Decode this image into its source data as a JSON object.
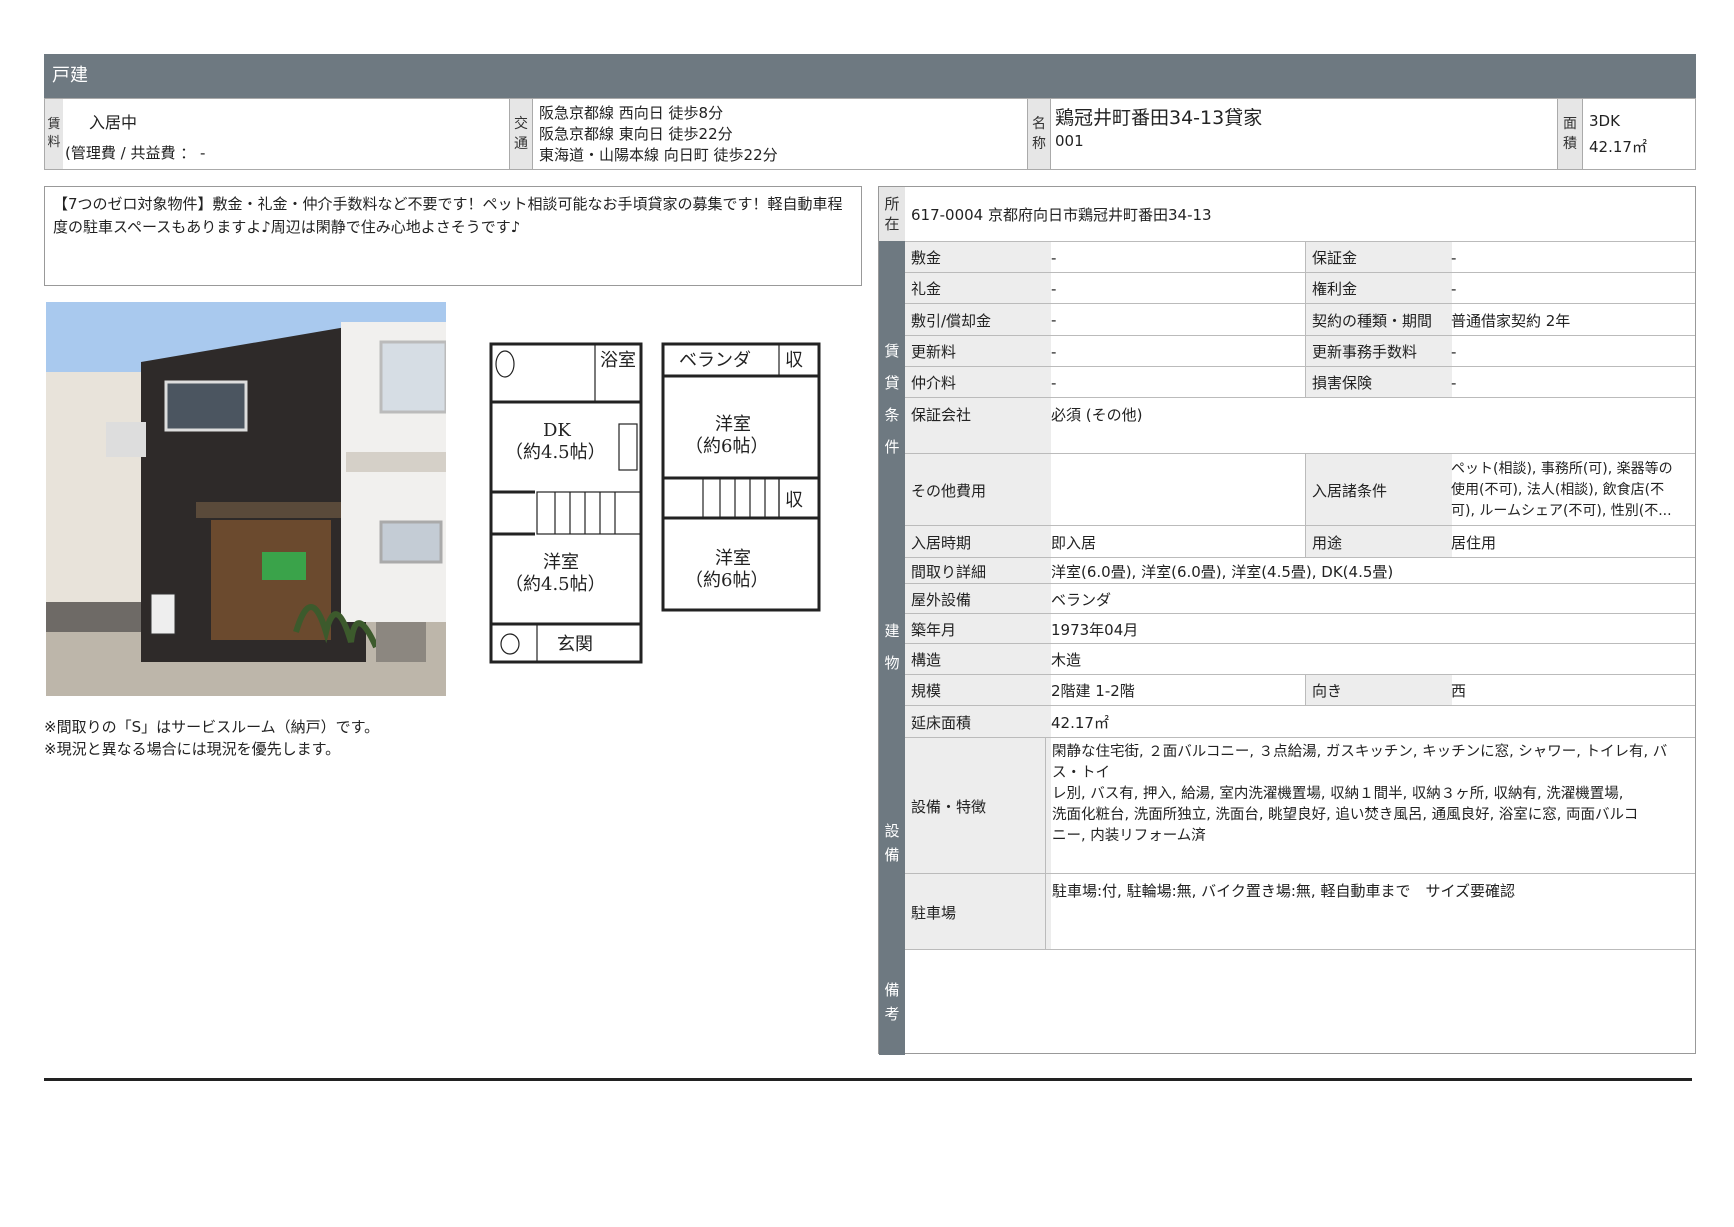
{
  "header": {
    "title": "戸建"
  },
  "top": {
    "rent_label": [
      "賃",
      "料"
    ],
    "rent_value": "入居中",
    "mgmt": "(管理費 / 共益費 ： -",
    "transit_label": [
      "交",
      "通"
    ],
    "transit": [
      "阪急京都線 西向日 徒歩8分",
      "阪急京都線 東向日 徒歩22分",
      "東海道・山陽本線 向日町 徒歩22分"
    ],
    "name_label": [
      "名",
      "称"
    ],
    "name": "鶏冠井町番田34-13貸家",
    "name_sub": "001",
    "area_label": [
      "面",
      "積"
    ],
    "layout": "3DK",
    "area": "42.17㎡"
  },
  "description": "【7つのゼロ対象物件】敷金・礼金・仲介手数料など不要です！ペット相談可能なお手頃貸家の募集です！軽自動車程度の駐車スペースもありますよ♪周辺は閑静で住み心地よさそうです♪",
  "notes": [
    "※間取りの「S」はサービスルーム（納戸）です。",
    "※現況と異なる場合には現況を優先します。"
  ],
  "floorplan": {
    "bath": "浴室",
    "dk": "DK",
    "dk_size": "（約4.5帖）",
    "w1": "洋室",
    "w1_size": "（約4.5帖）",
    "entrance": "玄関",
    "veranda": "ベランダ",
    "storage": "収",
    "w2": "洋室",
    "w2_size": "（約6帖）",
    "w3": "洋室",
    "w3_size": "（約6帖）"
  },
  "address": {
    "label": [
      "所",
      "在"
    ],
    "value": "617-0004 京都府向日市鶏冠井町番田34-13"
  },
  "sections": {
    "lease": [
      "賃",
      "貸",
      "条",
      "件"
    ],
    "building": [
      "建",
      "物"
    ],
    "equipment": [
      "設",
      "備"
    ],
    "remarks": [
      "備",
      "考"
    ]
  },
  "lease": {
    "shikikin": {
      "k": "敷金",
      "v": "-"
    },
    "hoshokin": {
      "k": "保証金",
      "v": "-"
    },
    "reikin": {
      "k": "礼金",
      "v": "-"
    },
    "kenrikin": {
      "k": "権利金",
      "v": "-"
    },
    "shikibiki": {
      "k": "敷引/償却金",
      "v": "-"
    },
    "contract": {
      "k": "契約の種類・期間",
      "v": "普通借家契約 2年"
    },
    "renewal": {
      "k": "更新料",
      "v": "-"
    },
    "renewal_fee": {
      "k": "更新事務手数料",
      "v": "-"
    },
    "brokerage": {
      "k": "仲介料",
      "v": "-"
    },
    "insurance": {
      "k": "損害保険",
      "v": "-"
    },
    "guarantor": {
      "k": "保証会社",
      "v": "必須 (その他)"
    },
    "other": {
      "k": "その他費用",
      "v": ""
    },
    "conditions": {
      "k": "入居諸条件",
      "v": [
        "ペット(相談), 事務所(可), 楽器等の",
        "使用(不可), 法人(相談), 飲食店(不",
        "可), ルームシェア(不可), 性別(不..."
      ]
    },
    "movein": {
      "k": "入居時期",
      "v": "即入居"
    },
    "use": {
      "k": "用途",
      "v": "居住用"
    }
  },
  "building": {
    "layout_detail": {
      "k": "間取り詳細",
      "v": "洋室(6.0畳), 洋室(6.0畳), 洋室(4.5畳), DK(4.5畳)"
    },
    "outdoor": {
      "k": "屋外設備",
      "v": "ベランダ"
    },
    "built": {
      "k": "築年月",
      "v": "1973年04月"
    },
    "structure": {
      "k": "構造",
      "v": "木造"
    },
    "scale": {
      "k": "規模",
      "v": "2階建 1-2階"
    },
    "direction": {
      "k": "向き",
      "v": "西"
    },
    "floor_area": {
      "k": "延床面積",
      "v": "42.17㎡"
    }
  },
  "equipment": {
    "features": {
      "k": "設備・特徴",
      "v": [
        "閑静な住宅街, ２面バルコニー, ３点給湯, ガスキッチン, キッチンに窓, シャワー, トイレ有, バス・トイ",
        "レ別, バス有, 押入, 給湯, 室内洗濯機置場, 収納１間半, 収納３ヶ所, 収納有, 洗濯機置場,",
        "洗面化粧台, 洗面所独立, 洗面台, 眺望良好, 追い焚き風呂, 通風良好, 浴室に窓, 両面バルコ",
        "ニー, 内装リフォーム済"
      ]
    },
    "parking": {
      "k": "駐車場",
      "v": "駐車場:付, 駐輪場:無, バイク置き場:無, 軽自動車まで　サイズ要確認"
    }
  }
}
